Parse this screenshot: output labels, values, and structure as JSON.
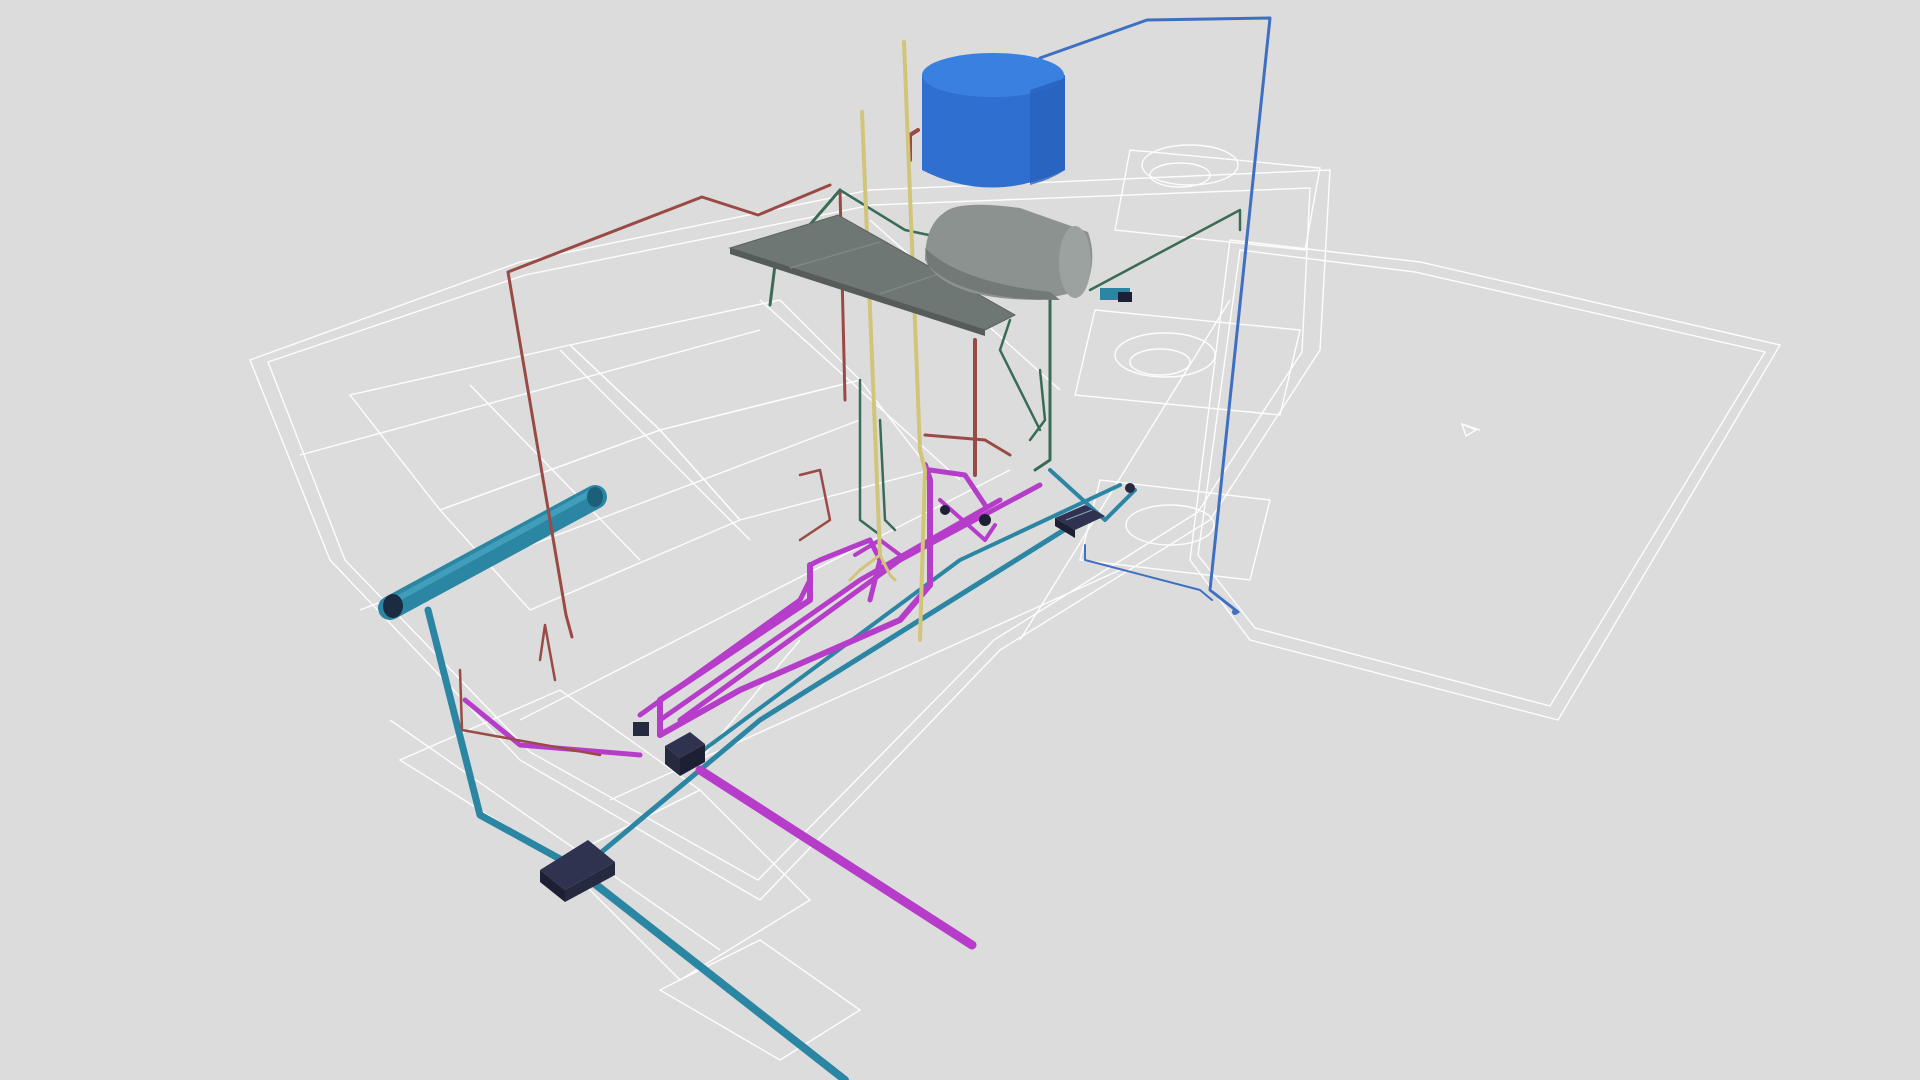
{
  "scene": {
    "background": "#dcdcdc",
    "colors": {
      "floorplan": "#ffffff",
      "storm_drain": "#2b86a3",
      "storm_drain_dark": "#1f6f8b",
      "sewer": "#b63dc9",
      "cold_water": "#3a6b55",
      "hot_water": "#9a4a44",
      "vent": "#d1c57a",
      "supply_line": "#3e6fc1",
      "water_tank": "#2e6fd0",
      "water_tank_top": "#3a80e0",
      "water_heater": "#8c9290",
      "solar_panel": "#6f7775",
      "inspection_box": "#262a40"
    },
    "components": [
      {
        "id": "water-tank",
        "label": ""
      },
      {
        "id": "water-heater",
        "label": ""
      },
      {
        "id": "solar-panel",
        "label": ""
      },
      {
        "id": "gutter",
        "label": ""
      },
      {
        "id": "inspection-box-main",
        "label": ""
      },
      {
        "id": "inspection-box-small",
        "label": ""
      }
    ]
  }
}
